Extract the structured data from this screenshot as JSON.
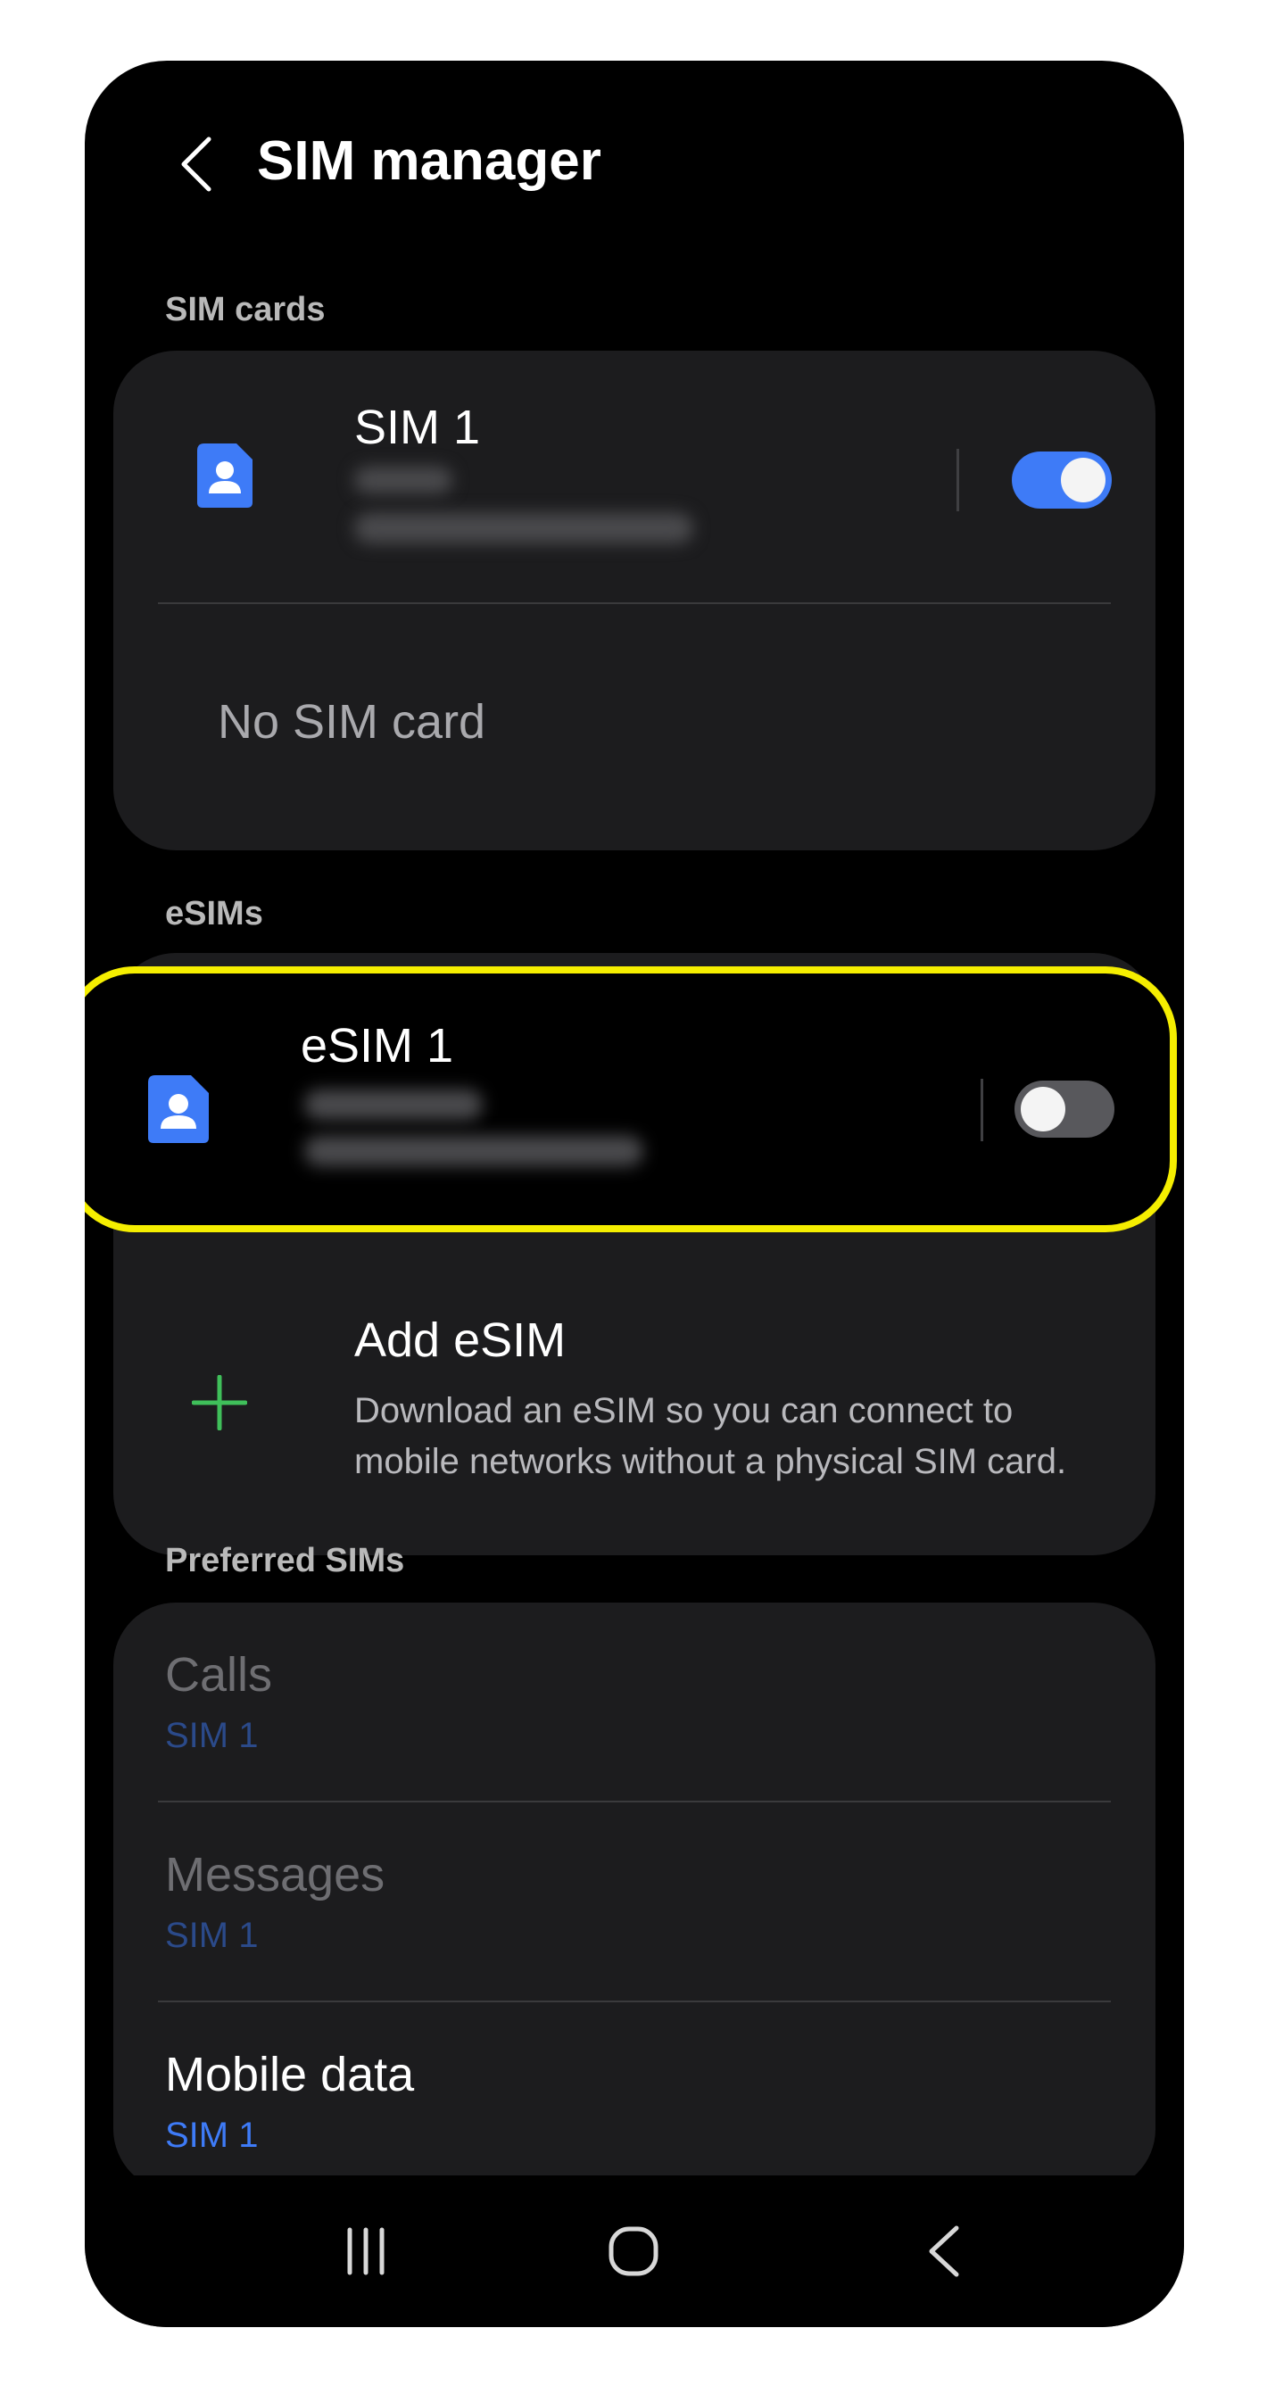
{
  "header": {
    "title": "SIM manager"
  },
  "sections": {
    "sim_cards": "SIM cards",
    "esims": "eSIMs",
    "preferred": "Preferred SIMs"
  },
  "sim_cards": {
    "sim1": {
      "name": "SIM 1",
      "enabled": true
    },
    "slot2": {
      "label": "No SIM card"
    }
  },
  "esims": {
    "esim1": {
      "name": "eSIM 1",
      "enabled": false
    },
    "add": {
      "title": "Add eSIM",
      "description": "Download an eSIM so you can connect to mobile networks without a physical SIM card."
    }
  },
  "preferred": {
    "calls": {
      "label": "Calls",
      "value": "SIM 1"
    },
    "messages": {
      "label": "Messages",
      "value": "SIM 1"
    },
    "mobile_data": {
      "label": "Mobile data",
      "value": "SIM 1"
    }
  },
  "colors": {
    "accent": "#3e7bf7",
    "highlight": "#f5ee00",
    "add_icon": "#3fbf5a",
    "card": "#1c1c1e"
  },
  "icons": [
    "back-arrow-icon",
    "sim-card-icon",
    "plus-icon",
    "recents-icon",
    "home-icon",
    "nav-back-icon"
  ]
}
